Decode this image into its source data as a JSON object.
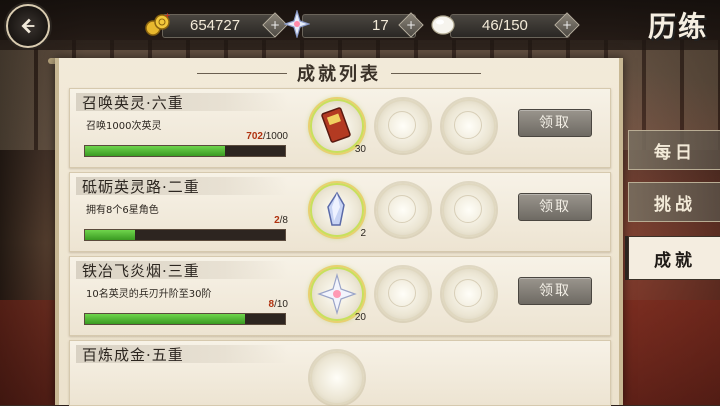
{
  "resources": {
    "gold": "654727",
    "stars": "17",
    "stamina": "46/150"
  },
  "page_title": "历练",
  "panel_title": "成就列表",
  "achievements": [
    {
      "name": "召唤英灵·六重",
      "desc": "召唤1000次英灵",
      "progress_current": "702",
      "progress_total": "/1000",
      "progress": 0.702,
      "reward_count": "30",
      "claim_label": "领取"
    },
    {
      "name": "砥砺英灵路·二重",
      "desc": "拥有8个6星角色",
      "progress_current": "2",
      "progress_total": "/8",
      "progress": 0.25,
      "reward_count": "2",
      "claim_label": "领取"
    },
    {
      "name": "铁冶飞炎烟·三重",
      "desc": "10名英灵的兵刃升阶至30阶",
      "progress_current": "8",
      "progress_total": "/10",
      "progress": 0.8,
      "reward_count": "20",
      "claim_label": "领取"
    },
    {
      "name": "百炼成金·五重"
    }
  ],
  "tabs": [
    {
      "label": "每日",
      "active": false
    },
    {
      "label": "挑战",
      "active": false
    },
    {
      "label": "成就",
      "active": true
    }
  ],
  "colors": {
    "progress_green": "#4cb82c",
    "progress_current": "#b0320f"
  }
}
